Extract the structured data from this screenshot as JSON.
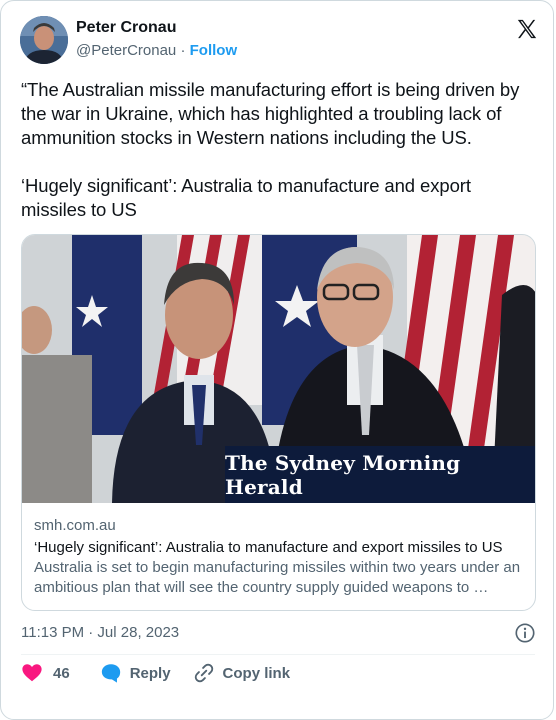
{
  "author": {
    "name": "Peter Cronau",
    "handle": "@PeterCronau",
    "separator": "·",
    "follow_label": "Follow"
  },
  "tweet": {
    "text": "“The Australian missile manufacturing effort is being driven by the war in Ukraine, which has highlighted a troubling lack of ammunition stocks in Western nations including the US.\n\n‘Hugely significant’: Australia to manufacture and export missiles to US",
    "timestamp": "11:13 PM · Jul 28, 2023"
  },
  "card": {
    "masthead": "The Sydney Morning Herald",
    "domain": "smh.com.au",
    "title": "‘Hugely significant’: Australia to manufacture and export missiles to US",
    "description": "Australia is set to begin manufacturing missiles within two years under an ambitious plan that will see the country supply guided weapons to …"
  },
  "actions": {
    "like_count": "46",
    "reply_label": "Reply",
    "copy_label": "Copy link"
  },
  "colors": {
    "accent": "#1d9bf0",
    "like": "#f91880",
    "text_secondary": "#536471",
    "border": "#cfd9de"
  },
  "icons": [
    "x-logo-icon",
    "info-icon",
    "heart-icon",
    "reply-bubble-icon",
    "link-icon"
  ]
}
